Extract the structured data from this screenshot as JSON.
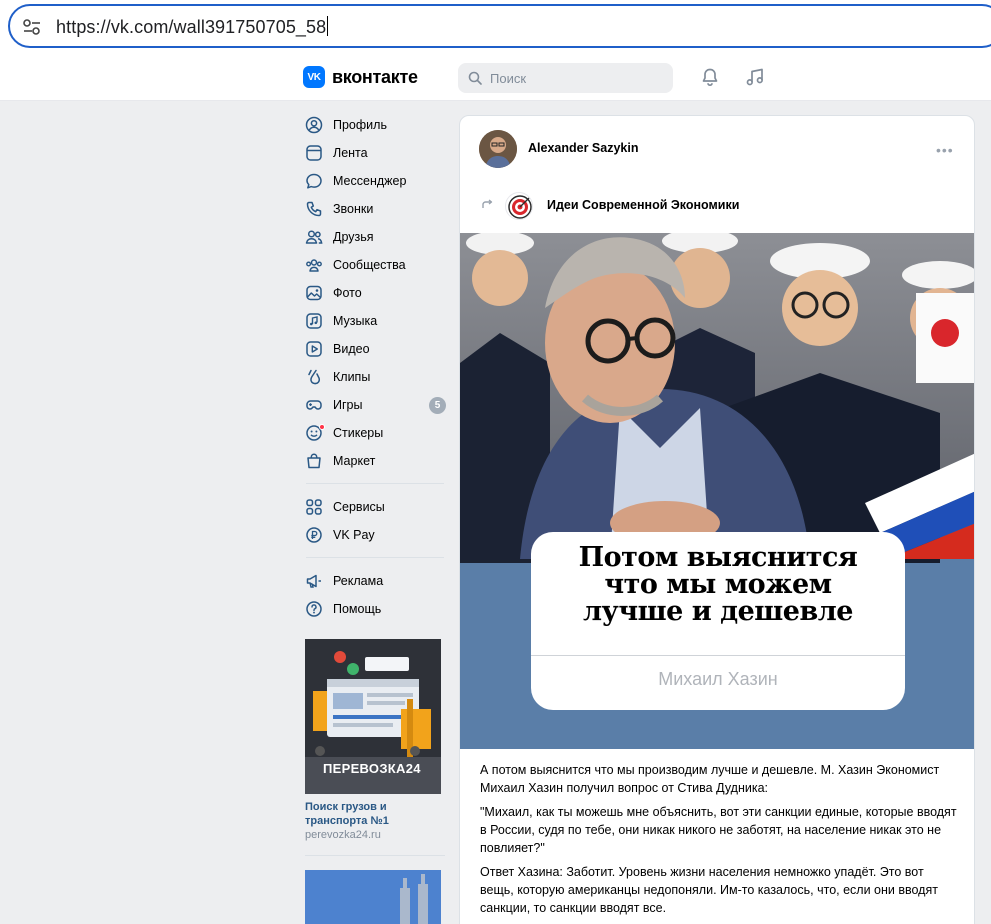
{
  "browser": {
    "url": "https://vk.com/wall391750705_58"
  },
  "header": {
    "logo_mark": "VK",
    "logo_text": "вконтакте",
    "search_placeholder": "Поиск"
  },
  "nav": {
    "group1": [
      {
        "label": "Профиль",
        "icon": "profile-icon"
      },
      {
        "label": "Лента",
        "icon": "feed-icon"
      },
      {
        "label": "Мессенджер",
        "icon": "messenger-icon"
      },
      {
        "label": "Звонки",
        "icon": "calls-icon"
      },
      {
        "label": "Друзья",
        "icon": "friends-icon"
      },
      {
        "label": "Сообщества",
        "icon": "communities-icon"
      },
      {
        "label": "Фото",
        "icon": "photo-icon"
      },
      {
        "label": "Музыка",
        "icon": "music-icon"
      },
      {
        "label": "Видео",
        "icon": "video-icon"
      },
      {
        "label": "Клипы",
        "icon": "clips-icon"
      },
      {
        "label": "Игры",
        "icon": "games-icon",
        "badge": "5"
      },
      {
        "label": "Стикеры",
        "icon": "stickers-icon"
      },
      {
        "label": "Маркет",
        "icon": "market-icon"
      }
    ],
    "group2": [
      {
        "label": "Сервисы",
        "icon": "services-icon"
      },
      {
        "label": "VK Pay",
        "icon": "vkpay-icon"
      }
    ],
    "group3": [
      {
        "label": "Реклама",
        "icon": "ads-icon"
      },
      {
        "label": "Помощь",
        "icon": "help-icon"
      }
    ]
  },
  "ad": {
    "banner_text": "ПЕРЕВОЗКА24",
    "title": "Поиск грузов и транспорта №1",
    "domain": "perevozka24.ru"
  },
  "post": {
    "author": "Alexander Sazykin",
    "more": "•••",
    "group_name": "Идеи Современной Экономики",
    "quote_lines": [
      "Потом выяснится",
      "что мы можем",
      "лучше и дешевле"
    ],
    "quote_author": "Михаил Хазин",
    "paragraphs": [
      "А потом выяснится что мы производим лучше и дешевле. М. Хазин Экономист Михаил Хазин получил вопрос от Стива Дудника:",
      "\"Михаил, как ты можешь мне объяснить, вот эти санкции единые, которые вводят в России, судя по тебе, они никак никого не заботят, на население никак это не повлияет?\"",
      "Ответ Хазина: Заботит. Уровень жизни населения немножко упадёт. Это вот вещь, которую американцы недопоняли. Им-то казалось, что, если они вводят санкции, то санкции вводят все."
    ]
  },
  "colors": {
    "accent": "#0077ff",
    "address_border": "#1f5fc9",
    "badge": "#a3adb8",
    "link": "#2a5885"
  }
}
